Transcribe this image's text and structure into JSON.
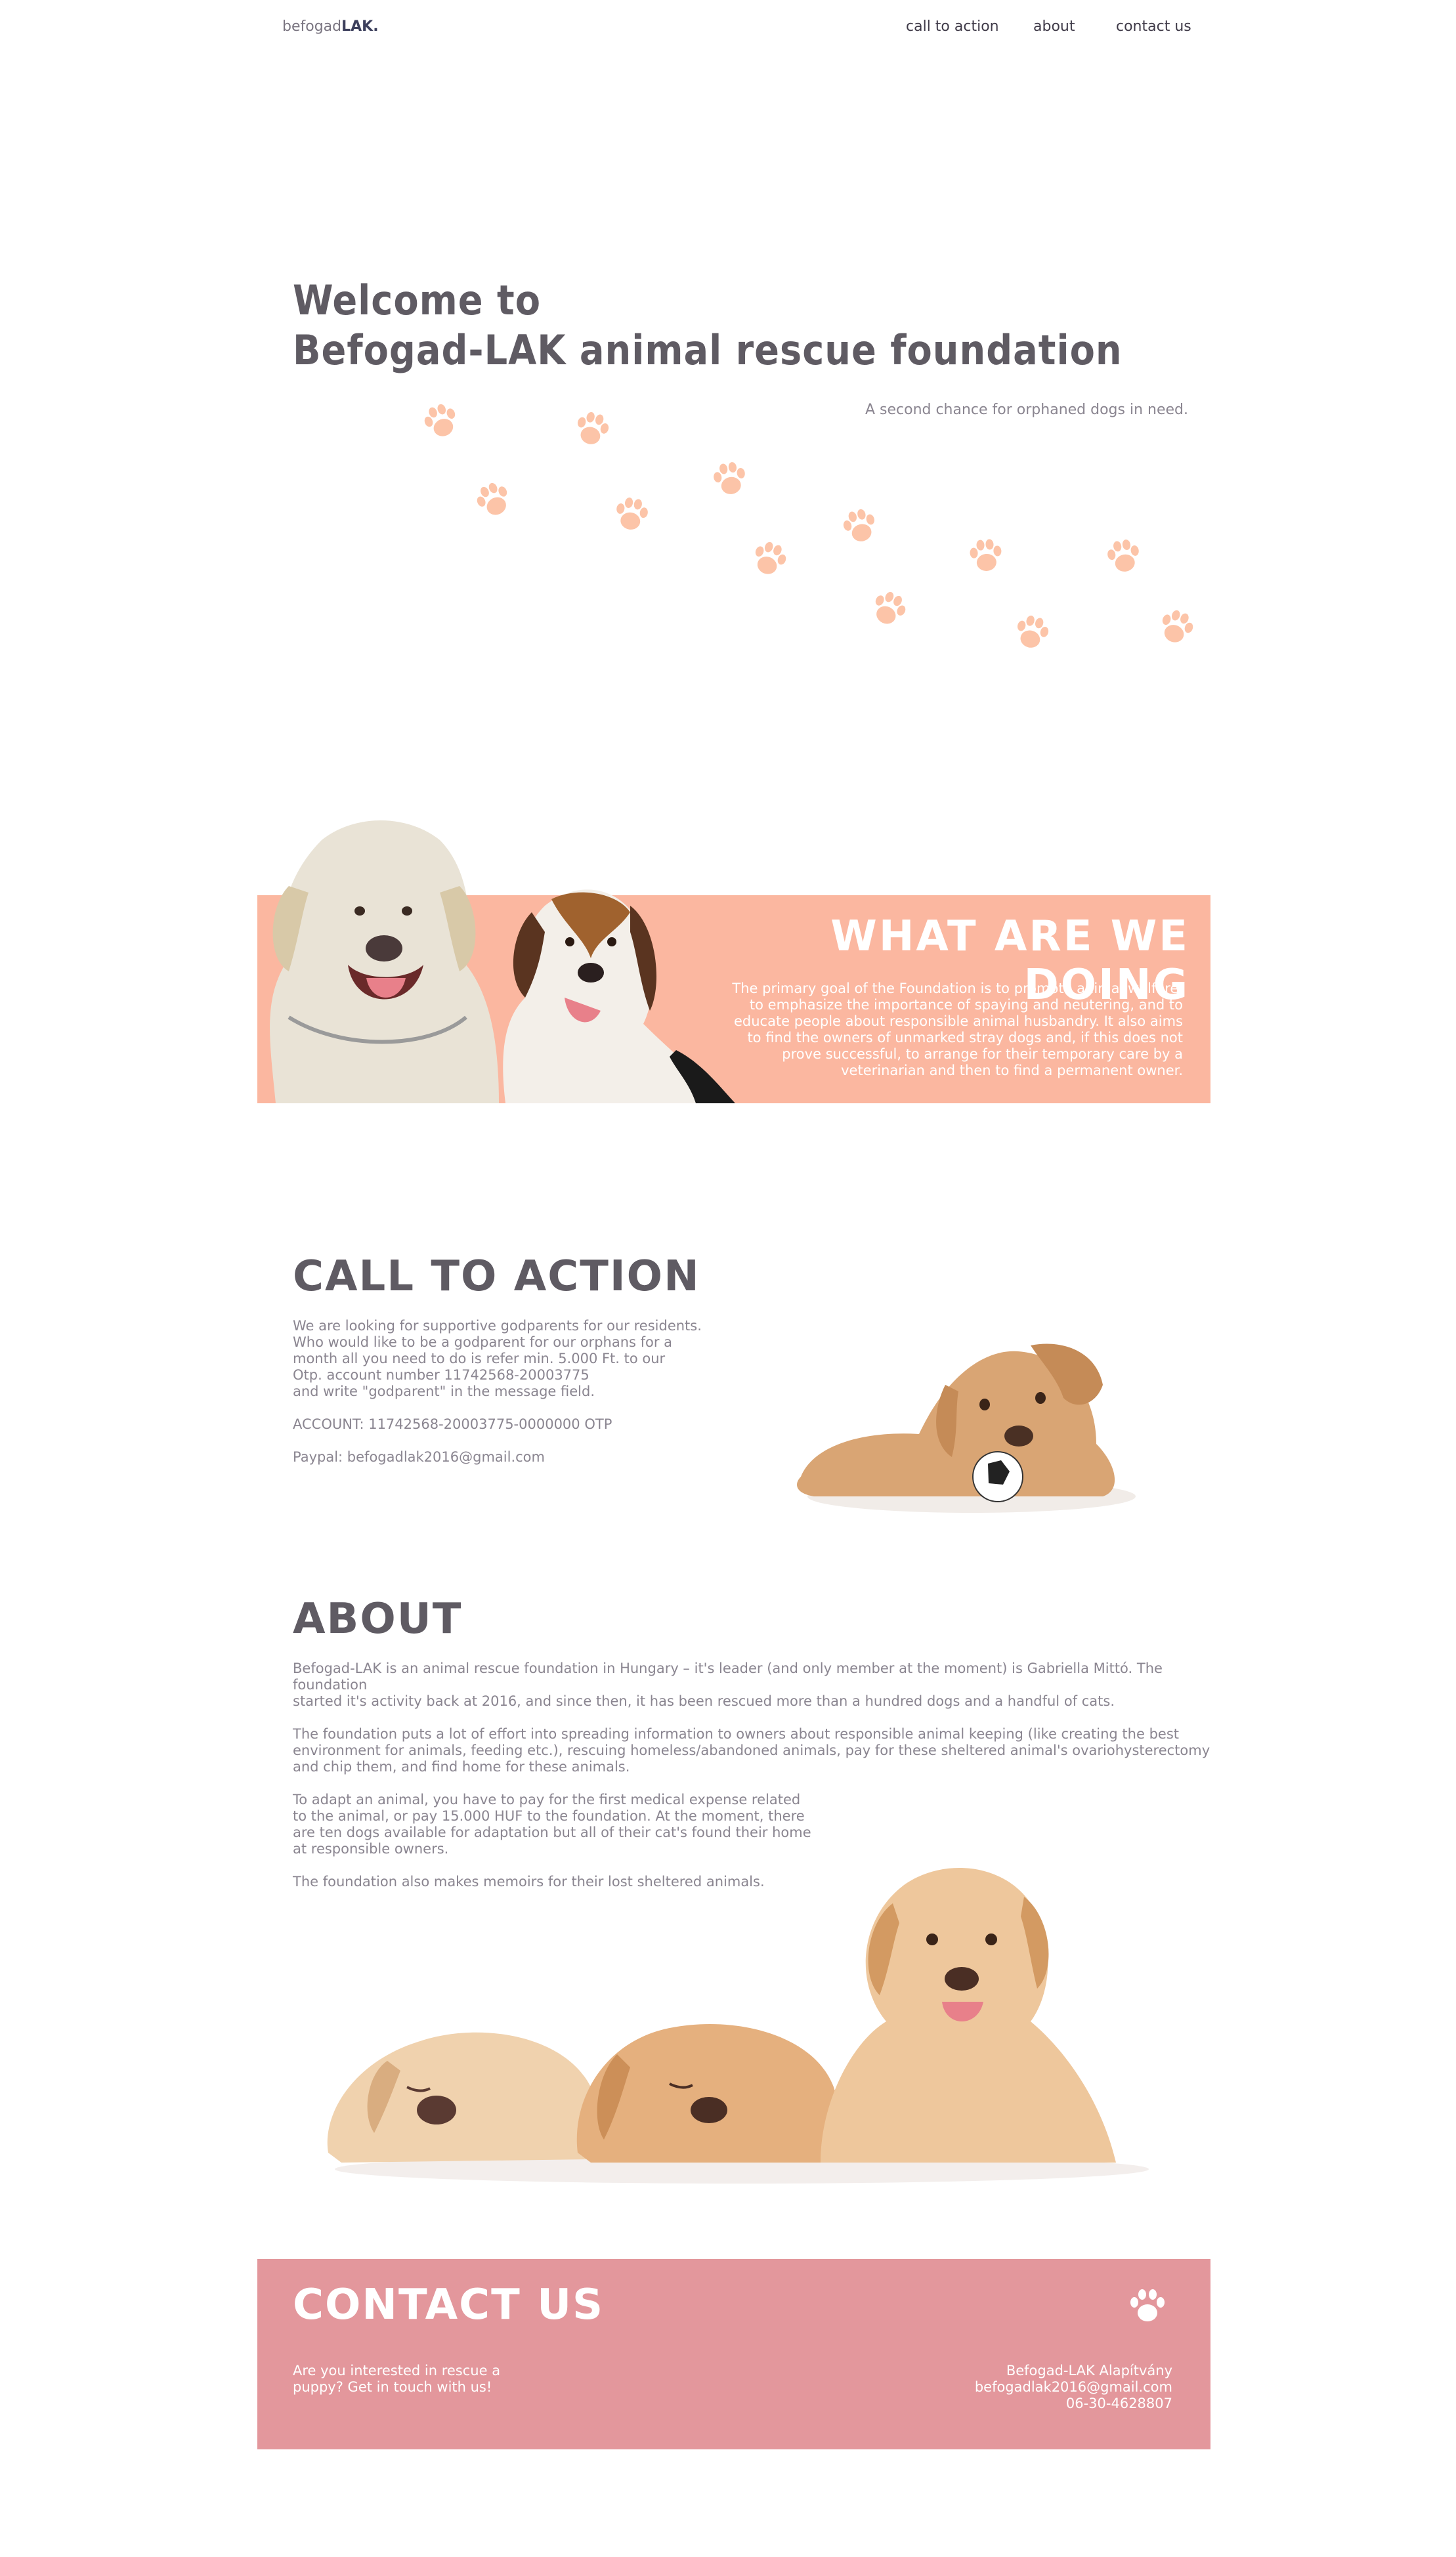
{
  "nav": {
    "brand_prefix": "befogad",
    "brand_bold": "LAK.",
    "links": [
      "call to action",
      "about",
      "contact us"
    ]
  },
  "hero": {
    "title": "Welcome to\nBefogad-LAK animal rescue foundation",
    "subtitle": "A second chance for orphaned dogs in need."
  },
  "what_we_do": {
    "title": "WHAT ARE WE DOING",
    "text": "The primary goal of the Foundation is to promote animal welfare,\nto emphasize the importance of spaying and neutering, and to\neducate people about responsible animal husbandry. It also aims\nto find the owners of unmarked stray dogs and, if this does not\nprove successful, to arrange for their temporary care by a\nveterinarian and then to find a permanent owner."
  },
  "call_to_action": {
    "title": "CALL TO ACTION",
    "text": "We are looking for supportive godparents for our residents.\nWho would like to be a godparent for our orphans for a\nmonth all you need to do is refer min. 5.000 Ft. to our\nOtp. account number 11742568-20003775\nand write \"godparent\" in the message field.",
    "account": "ACCOUNT: 11742568-20003775-0000000 OTP",
    "paypal": "Paypal: befogadlak2016@gmail.com"
  },
  "about": {
    "title": "ABOUT",
    "paragraphs": [
      "Befogad-LAK is an animal rescue foundation in Hungary – it's leader (and only member at the moment) is Gabriella Mittó. The foundation\nstarted it's activity back at 2016, and since then, it has been rescued more than a hundred dogs and a handful of cats.",
      "The foundation puts a lot of effort into spreading information to owners about responsible animal keeping (like creating the best\nenvironment for animals, feeding etc.), rescuing homeless/abandoned animals, pay for these sheltered animal's ovariohysterectomy\nand chip them, and find home for these animals.",
      "To adapt an animal, you have to pay for the first medical expense related\nto the animal, or pay 15.000 HUF to the foundation. At the moment, there\nare ten dogs available for adaptation but all of their cat's found their home\nat responsible owners.",
      "The foundation also makes memoirs for their lost sheltered animals."
    ]
  },
  "contact": {
    "title": "CONTACT US",
    "text": "Are you interested in rescue a\npuppy? Get in touch with us!",
    "org": "Befogad-LAK Alapítvány",
    "email": "befogadlak2016@gmail.com",
    "phone": "06-30-4628807"
  },
  "colors": {
    "accent_peach": "#fbb7a0",
    "paw_color": "#fcc4a8",
    "contact_pink": "#e3979c",
    "heading": "#5f5b63"
  },
  "icons": [
    "paw-print-icon"
  ]
}
